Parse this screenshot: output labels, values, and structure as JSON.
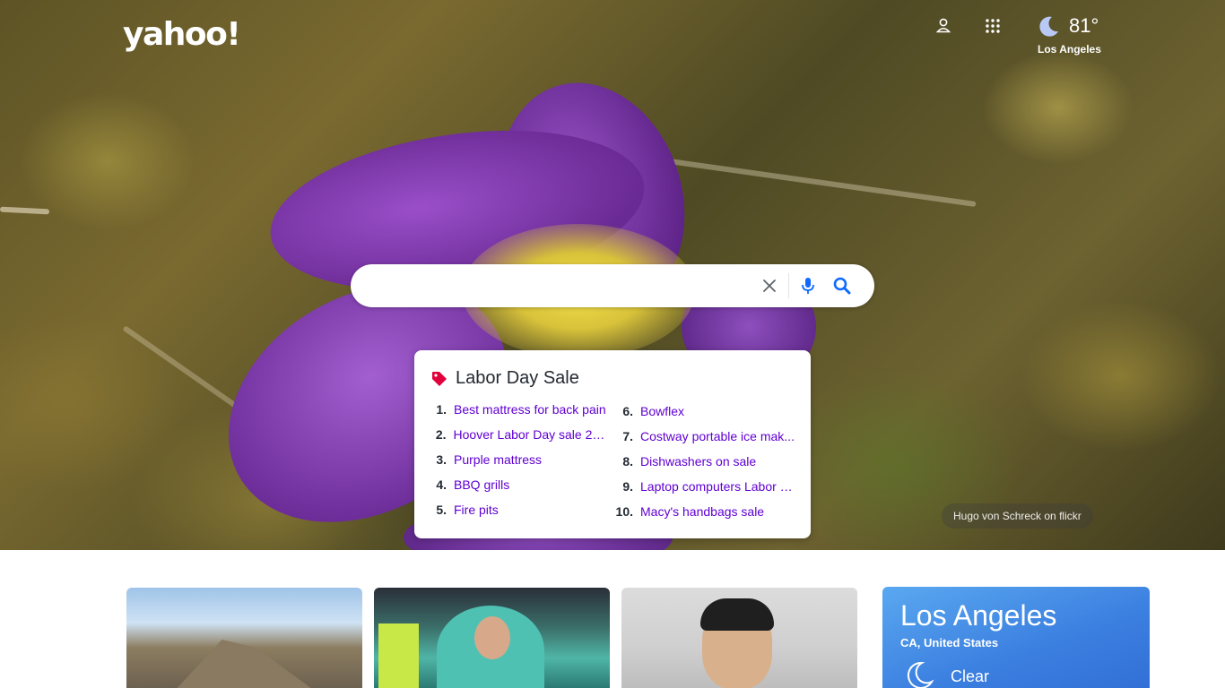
{
  "header": {
    "logo": "yahoo!",
    "weather": {
      "temperature": "81°",
      "city": "Los Angeles",
      "icon": "moon-icon"
    }
  },
  "search": {
    "placeholder": "",
    "value": ""
  },
  "trending": {
    "title": "Labor Day Sale",
    "items": [
      {
        "num": "1.",
        "text": "Best mattress for back pain"
      },
      {
        "num": "2.",
        "text": "Hoover Labor Day sale 20..."
      },
      {
        "num": "3.",
        "text": "Purple mattress"
      },
      {
        "num": "4.",
        "text": "BBQ grills"
      },
      {
        "num": "5.",
        "text": "Fire pits"
      },
      {
        "num": "6.",
        "text": "Bowflex"
      },
      {
        "num": "7.",
        "text": "Costway portable ice mak..."
      },
      {
        "num": "8.",
        "text": "Dishwashers on sale"
      },
      {
        "num": "9.",
        "text": "Laptop computers Labor D..."
      },
      {
        "num": "10.",
        "text": "Macy's handbags sale"
      }
    ]
  },
  "photo_credit": "Hugo von Schreck on flickr",
  "weather_card": {
    "city": "Los Angeles",
    "region": "CA, United States",
    "condition": "Clear"
  },
  "colors": {
    "link": "#6001d2",
    "weather_card": "#3b7fe0",
    "tag_icon": "#e0003c"
  }
}
